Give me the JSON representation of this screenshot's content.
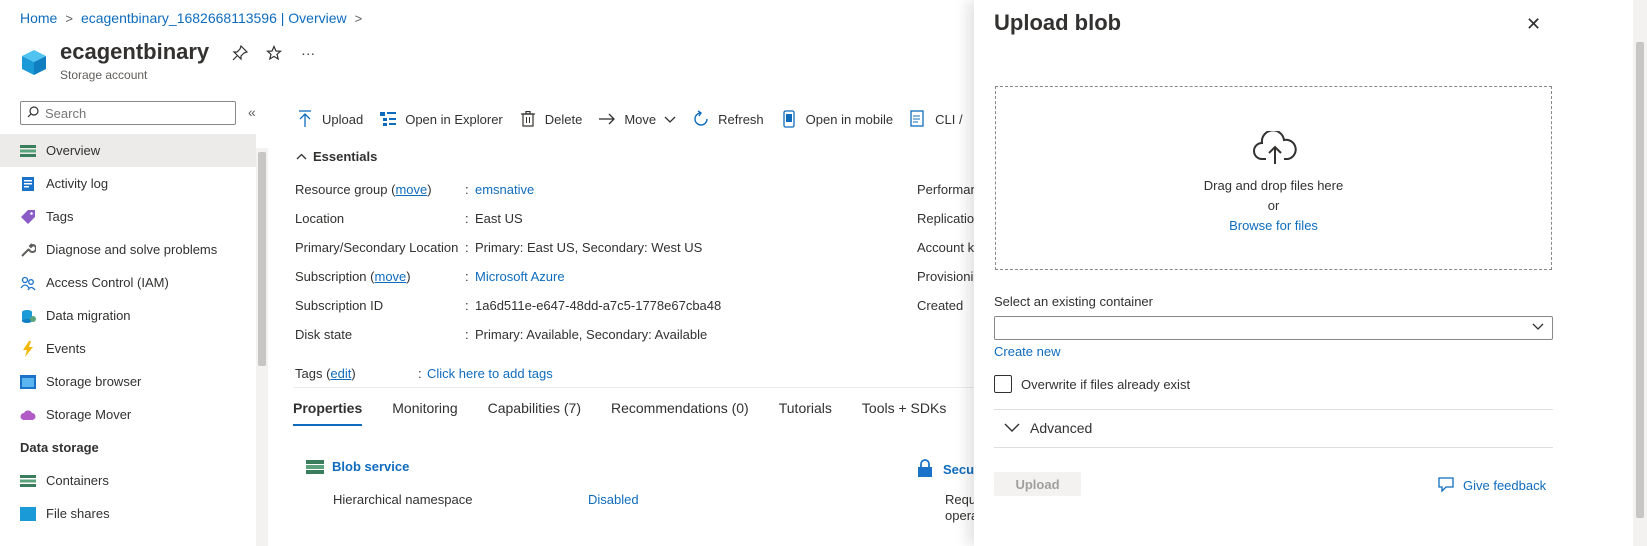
{
  "breadcrumb": {
    "home": "Home",
    "resource": "ecagentbinary_1682668113596 | Overview"
  },
  "resource": {
    "title": "ecagentbinary",
    "subtitle": "Storage account",
    "more": "···"
  },
  "sidebar": {
    "search_placeholder": "Search",
    "collapse": "«",
    "items": [
      {
        "label": "Overview",
        "icon": "overview-icon"
      },
      {
        "label": "Activity log",
        "icon": "activity-log-icon"
      },
      {
        "label": "Tags",
        "icon": "tag-icon"
      },
      {
        "label": "Diagnose and solve problems",
        "icon": "wrench-icon"
      },
      {
        "label": "Access Control (IAM)",
        "icon": "people-icon"
      },
      {
        "label": "Data migration",
        "icon": "data-migration-icon"
      },
      {
        "label": "Events",
        "icon": "lightning-icon"
      },
      {
        "label": "Storage browser",
        "icon": "storage-browser-icon"
      },
      {
        "label": "Storage Mover",
        "icon": "cloud-icon"
      }
    ],
    "section_data_storage": "Data storage",
    "data_items": [
      {
        "label": "Containers",
        "icon": "containers-icon"
      },
      {
        "label": "File shares",
        "icon": "file-shares-icon"
      }
    ]
  },
  "toolbar": {
    "upload": "Upload",
    "open_explorer": "Open in Explorer",
    "delete": "Delete",
    "move": "Move",
    "refresh": "Refresh",
    "open_mobile": "Open in mobile",
    "cli": "CLI /"
  },
  "essentials": {
    "title": "Essentials",
    "rows": [
      {
        "label": "Resource group",
        "link": "move",
        "value": "emsnative",
        "value_is_link": true
      },
      {
        "label": "Location",
        "value": "East US"
      },
      {
        "label": "Primary/Secondary Location",
        "value": "Primary: East US, Secondary: West US"
      },
      {
        "label": "Subscription",
        "link": "move",
        "value": "Microsoft Azure",
        "value_is_link": true
      },
      {
        "label": "Subscription ID",
        "value": "1a6d511e-e647-48dd-a7c5-1778e67cba48"
      },
      {
        "label": "Disk state",
        "value": "Primary: Available, Secondary: Available"
      }
    ],
    "tags_label": "Tags",
    "tags_link": "edit",
    "tags_value": "Click here to add tags",
    "right_labels": [
      "Performan",
      "Replicatio",
      "Account k",
      "Provisioni",
      "Created"
    ]
  },
  "tabs": [
    "Properties",
    "Monitoring",
    "Capabilities (7)",
    "Recommendations (0)",
    "Tutorials",
    "Tools + SDKs"
  ],
  "properties": {
    "blob_service": "Blob service",
    "hns_label": "Hierarchical namespace",
    "hns_value": "Disabled",
    "security_title": "Secu",
    "security_sub1": "Requ",
    "security_sub2": "opera"
  },
  "panel": {
    "title": "Upload blob",
    "close": "✕",
    "drop_text": "Drag and drop files here",
    "or_text": "or",
    "browse": "Browse for files",
    "container_label": "Select an existing container",
    "container_value": "",
    "create_new": "Create new",
    "overwrite_label": "Overwrite if files already exist",
    "overwrite_checked": false,
    "advanced": "Advanced",
    "upload_button": "Upload",
    "feedback": "Give feedback"
  }
}
